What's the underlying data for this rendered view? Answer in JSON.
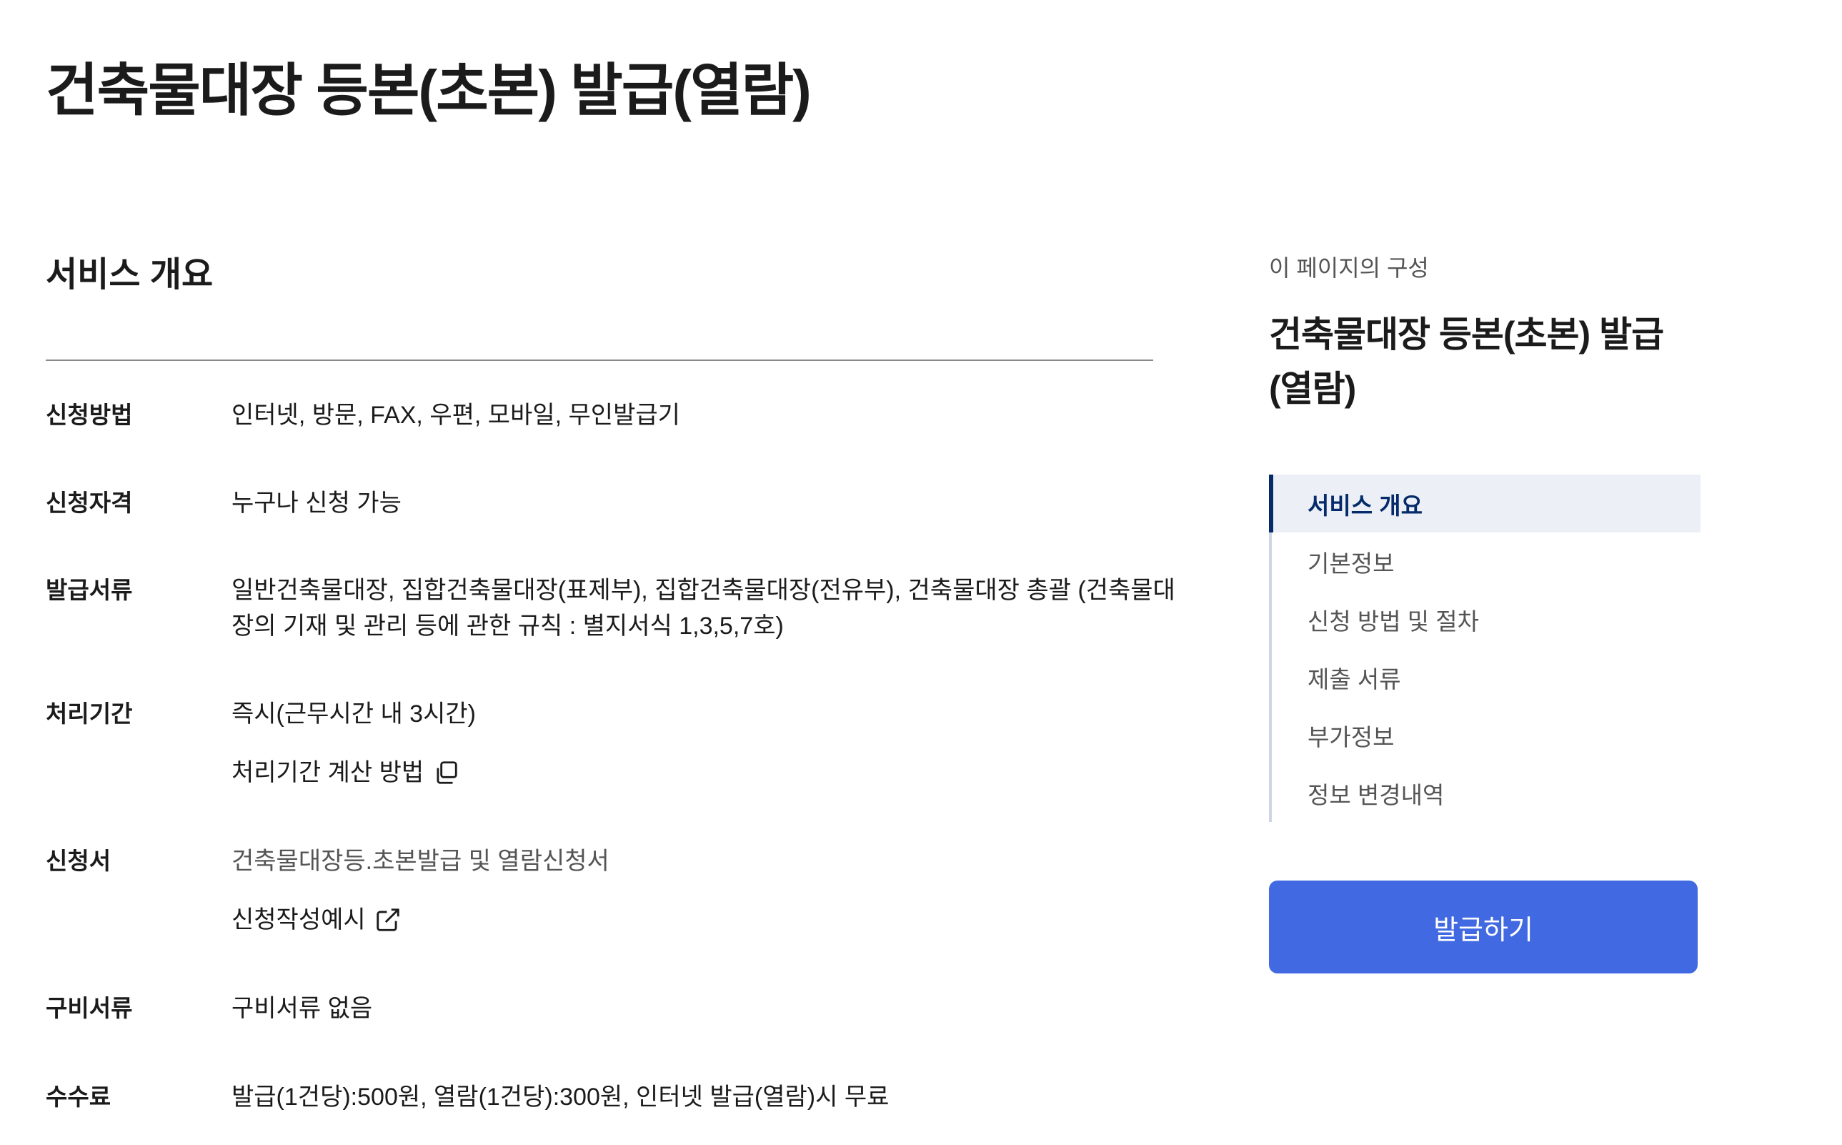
{
  "page": {
    "title": "건축물대장 등본(초본) 발급(열람)"
  },
  "overview": {
    "section_title": "서비스 개요",
    "rows": {
      "method": {
        "label": "신청방법",
        "value": "인터넷, 방문, FAX, 우편, 모바일, 무인발급기"
      },
      "eligibility": {
        "label": "신청자격",
        "value": "누구나 신청 가능"
      },
      "documents": {
        "label": "발급서류",
        "value": "일반건축물대장, 집합건축물대장(표제부), 집합건축물대장(전유부), 건축물대장 총괄 (건축물대장의 기재 및 관리 등에 관한 규칙 : 별지서식 1,3,5,7호)"
      },
      "period": {
        "label": "처리기간",
        "value": "즉시(근무시간 내 3시간)",
        "link_label": "처리기간 계산 방법",
        "link_icon": "copy-icon"
      },
      "form": {
        "label": "신청서",
        "value": "건축물대장등.초본발급 및 열람신청서",
        "link_label": "신청작성예시",
        "link_icon": "external-link-icon"
      },
      "required": {
        "label": "구비서류",
        "value": "구비서류 없음"
      },
      "fee": {
        "label": "수수료",
        "value": "발급(1건당):500원, 열람(1건당):300원, 인터넷 발급(열람)시 무료"
      }
    }
  },
  "toc": {
    "caption": "이 페이지의 구성",
    "title": "건축물대장 등본(초본) 발급(열람)",
    "items": [
      "서비스 개요",
      "기본정보",
      "신청 방법 및 절차",
      "제출 서류",
      "부가정보",
      "정보 변경내역"
    ],
    "active_index": 0
  },
  "actions": {
    "issue_label": "발급하기"
  },
  "colors": {
    "primary_button": "#4169e1",
    "active_nav": "#052b6b",
    "active_nav_bg": "#ecf0f6"
  }
}
